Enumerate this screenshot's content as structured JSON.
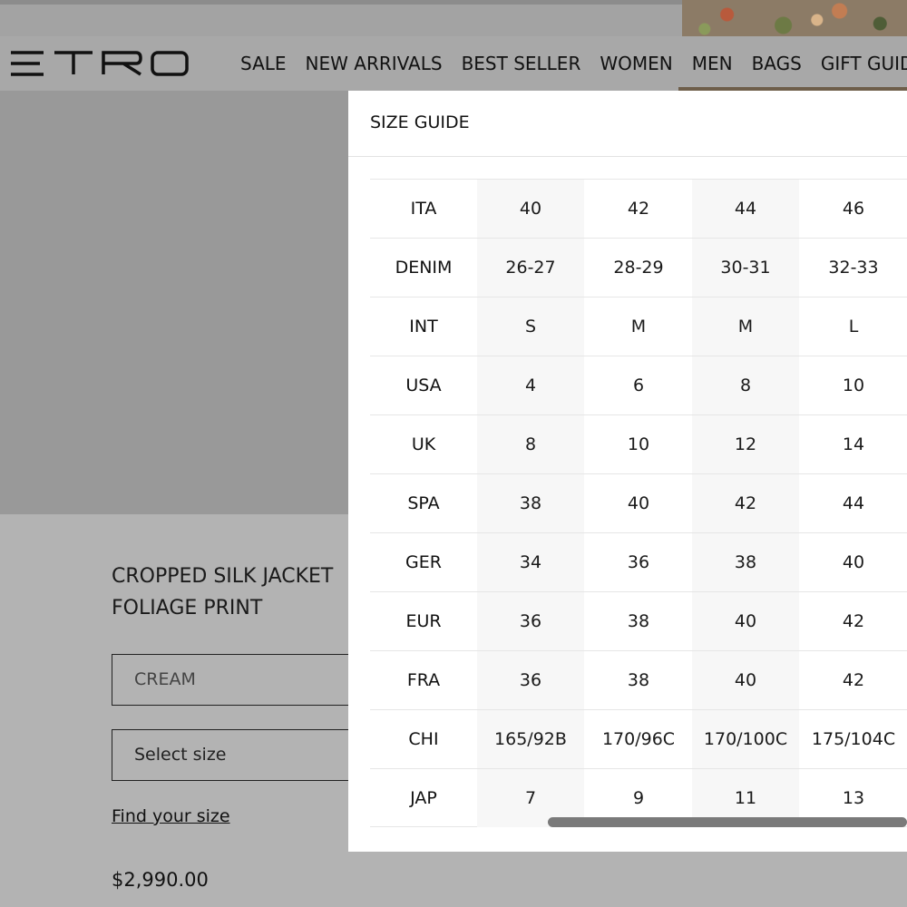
{
  "header": {
    "logo_text": "ETRO",
    "nav": [
      "SALE",
      "NEW ARRIVALS",
      "BEST SELLER",
      "WOMEN",
      "MEN",
      "BAGS",
      "GIFT GUIDE"
    ]
  },
  "product": {
    "title_line1": "CROPPED SILK JACKET",
    "title_line2": "FOLIAGE PRINT",
    "color_value": "CREAM",
    "size_placeholder": "Select size",
    "find_size_link": "Find your size",
    "price": "$2,990.00"
  },
  "size_guide": {
    "title": "SIZE GUIDE",
    "rows": [
      {
        "label": "ITA",
        "values": [
          "40",
          "42",
          "44",
          "46"
        ]
      },
      {
        "label": "DENIM",
        "values": [
          "26-27",
          "28-29",
          "30-31",
          "32-33"
        ]
      },
      {
        "label": "INT",
        "values": [
          "S",
          "M",
          "M",
          "L"
        ]
      },
      {
        "label": "USA",
        "values": [
          "4",
          "6",
          "8",
          "10"
        ]
      },
      {
        "label": "UK",
        "values": [
          "8",
          "10",
          "12",
          "14"
        ]
      },
      {
        "label": "SPA",
        "values": [
          "38",
          "40",
          "42",
          "44"
        ]
      },
      {
        "label": "GER",
        "values": [
          "34",
          "36",
          "38",
          "40"
        ]
      },
      {
        "label": "EUR",
        "values": [
          "36",
          "38",
          "40",
          "42"
        ]
      },
      {
        "label": "FRA",
        "values": [
          "36",
          "38",
          "40",
          "42"
        ]
      },
      {
        "label": "CHI",
        "values": [
          "165/92B",
          "170/96C",
          "170/100C",
          "175/104C"
        ]
      },
      {
        "label": "JAP",
        "values": [
          "7",
          "9",
          "11",
          "13"
        ]
      }
    ]
  }
}
